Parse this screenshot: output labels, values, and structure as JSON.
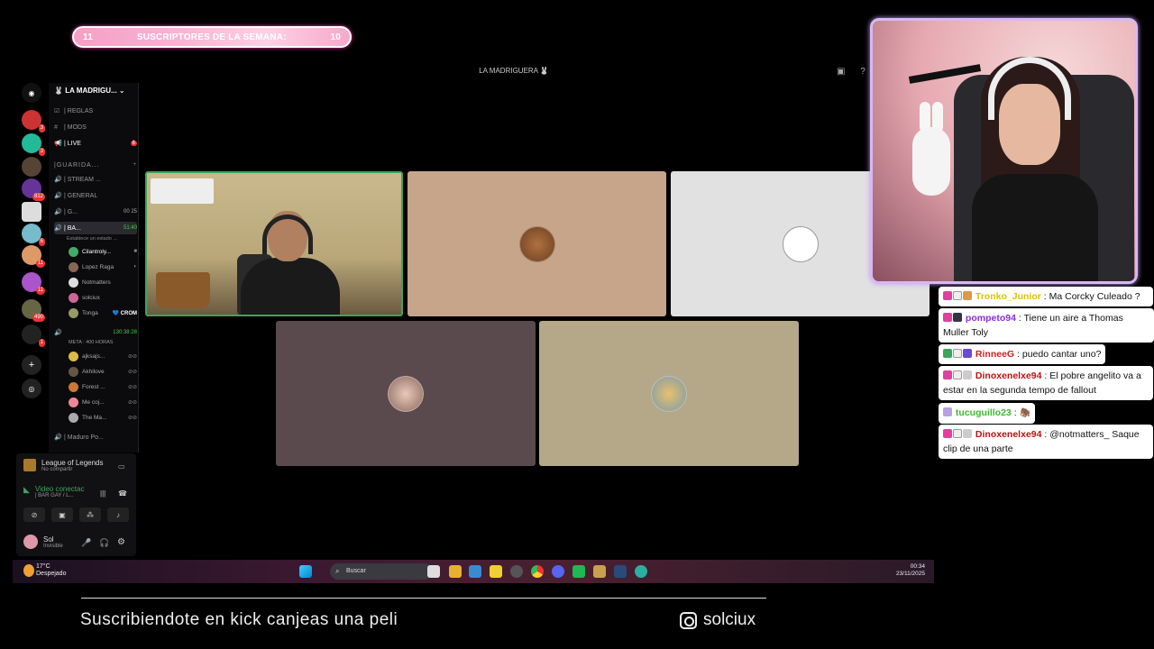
{
  "subscriber_bar": {
    "left_count": "11",
    "label": "SUSCRIPTORES DE LA SEMANA:",
    "right_count": "10"
  },
  "discord": {
    "window_title": "LA MADRIGUERA 🐰",
    "server_name": "LA MADRIGU...",
    "server_badges": [
      "3",
      "3",
      "812",
      "6",
      "11",
      "11",
      "490",
      "1"
    ],
    "channels": [
      {
        "label": "| REGLAS"
      },
      {
        "label": "| MODS"
      },
      {
        "label": "| LIVE",
        "count": "6"
      },
      {
        "label": "|GUARIDA..."
      },
      {
        "label": "| STREAM ..."
      },
      {
        "label": "| GENERAL"
      },
      {
        "label": "| G...",
        "count": "00  25"
      },
      {
        "label": "| BA...",
        "count": "51:40"
      },
      {
        "label": "Establece un estado ..."
      }
    ],
    "voice_users_a": [
      {
        "name": "Cilantroly..."
      },
      {
        "name": "Lopez Raga"
      },
      {
        "name": "Notmatters"
      },
      {
        "name": "solciux"
      },
      {
        "name": "Tonga",
        "tag": "💙 CROM"
      }
    ],
    "channel2": {
      "label": "130:38:28",
      "sub": "META : 400 HORAS"
    },
    "voice_users_b": [
      {
        "name": "ajksajs..."
      },
      {
        "name": "Akhilove"
      },
      {
        "name": "Forest ..."
      },
      {
        "name": "Me coj..."
      },
      {
        "name": "The Ma..."
      }
    ],
    "channel3": {
      "label": "| Maduro Po..."
    },
    "activity": {
      "title": "League of Legends",
      "sub": "No compartir"
    },
    "voice_status": {
      "title": "Video conectac",
      "sub": "| BAR GAY / L..."
    },
    "user": {
      "name": "Sol",
      "status": "Invisible"
    }
  },
  "chat": [
    {
      "name": "Tronko_Junior",
      "name_color": "#e0c000",
      "text": ": Ma Corcky Culeado ?"
    },
    {
      "name": "pompeto94",
      "name_color": "#8a2be2",
      "text": ": Tiene un aire a Thomas Muller Toly"
    },
    {
      "name": "RinneeG",
      "name_color": "#d02020",
      "text": ": puedo cantar uno?"
    },
    {
      "name": "Dinoxenelxe94",
      "name_color": "#c01010",
      "text": ": El pobre angelito va a estar en la segunda tempo de fallout"
    },
    {
      "name": "tucuguillo23",
      "name_color": "#3cba2c",
      "text": ":"
    },
    {
      "name": "Dinoxenelxe94",
      "name_color": "#c01010",
      "text": ": @notmatters_ Saque clip de una parte"
    }
  ],
  "taskbar": {
    "weather_temp": "17°C",
    "weather_desc": "Despejado",
    "search_label": "Buscar",
    "time": "00:34",
    "date": "23/11/2025"
  },
  "footer": {
    "promo": "Suscribiendote en kick canjeas una peli",
    "instagram": "solciux"
  },
  "colors": {
    "accent_green": "#3ba55c",
    "sub_bar_pink": "#f8b5d3",
    "webcam_border": "#d8b8f0"
  }
}
